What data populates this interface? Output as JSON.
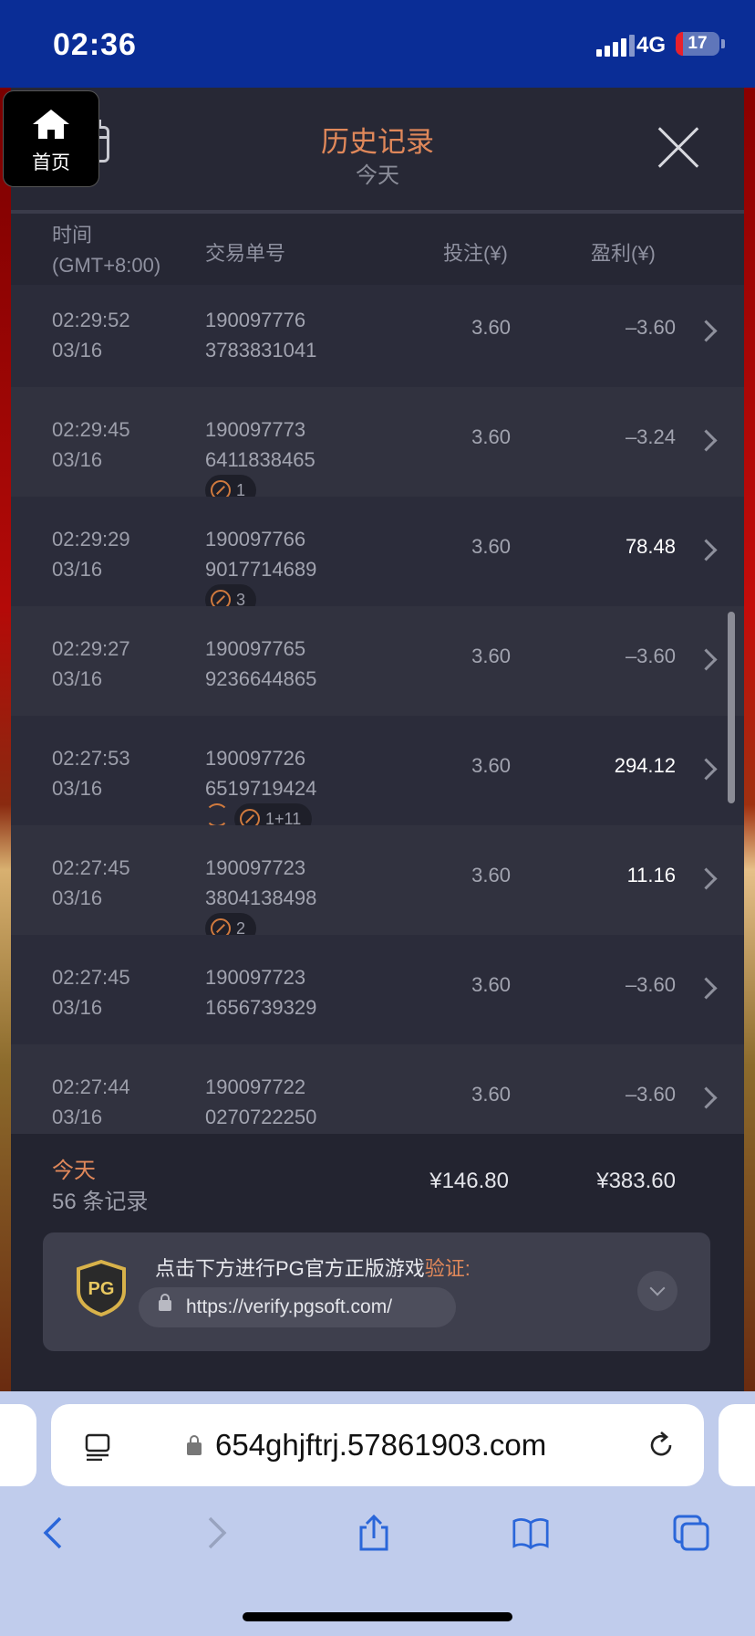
{
  "status_bar": {
    "time": "02:36",
    "network": "4G",
    "battery": "17",
    "battery_level": 0.17
  },
  "header": {
    "title": "历史记录",
    "subtitle": "今天"
  },
  "home_button": {
    "label": "首页"
  },
  "columns": {
    "time_line1": "时间",
    "time_line2": "(GMT+8:00)",
    "id": "交易单号",
    "bet": "投注(¥)",
    "profit": "盈利(¥)"
  },
  "records": [
    {
      "time": "02:29:52",
      "date": "03/16",
      "id1": "190097776",
      "id2": "3783831041",
      "bet": "3.60",
      "profit": "–3.60",
      "badges": []
    },
    {
      "time": "02:29:45",
      "date": "03/16",
      "id1": "190097773",
      "id2": "6411838465",
      "bet": "3.60",
      "profit": "–3.24",
      "badges": [
        {
          "icon": "free-game-icon",
          "text": "1"
        }
      ]
    },
    {
      "time": "02:29:29",
      "date": "03/16",
      "id1": "190097766",
      "id2": "9017714689",
      "bet": "3.60",
      "profit": "78.48",
      "badges": [
        {
          "icon": "free-game-icon",
          "text": "3"
        }
      ]
    },
    {
      "time": "02:29:27",
      "date": "03/16",
      "id1": "190097765",
      "id2": "9236644865",
      "bet": "3.60",
      "profit": "–3.60",
      "badges": []
    },
    {
      "time": "02:27:53",
      "date": "03/16",
      "id1": "190097726",
      "id2": "6519719424",
      "bet": "3.60",
      "profit": "294.12",
      "badges": [
        {
          "icon": "respin-icon",
          "text": ""
        },
        {
          "icon": "free-game-icon",
          "text": "1+11"
        }
      ]
    },
    {
      "time": "02:27:45",
      "date": "03/16",
      "id1": "190097723",
      "id2": "3804138498",
      "bet": "3.60",
      "profit": "11.16",
      "badges": [
        {
          "icon": "free-game-icon",
          "text": "2"
        }
      ]
    },
    {
      "time": "02:27:45",
      "date": "03/16",
      "id1": "190097723",
      "id2": "1656739329",
      "bet": "3.60",
      "profit": "–3.60",
      "badges": []
    },
    {
      "time": "02:27:44",
      "date": "03/16",
      "id1": "190097722",
      "id2": "0270722250",
      "bet": "3.60",
      "profit": "–3.60",
      "badges": []
    }
  ],
  "summary": {
    "period": "今天",
    "count": "56 条记录",
    "total_bet": "¥146.80",
    "total_profit": "¥383.60"
  },
  "verify": {
    "text": "点击下方进行PG官方正版游戏",
    "highlight": "验证:",
    "url": "https://verify.pgsoft.com/",
    "logo_text": "PG"
  },
  "browser": {
    "url": "654ghjftrj.57861903.com"
  }
}
